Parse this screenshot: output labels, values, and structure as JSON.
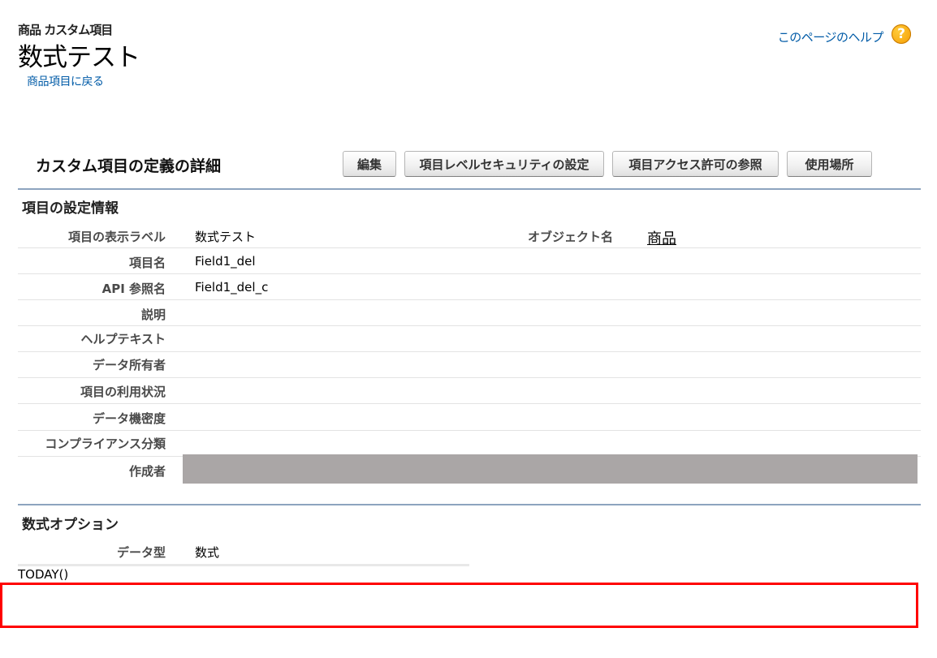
{
  "header": {
    "object_label": "商品 カスタム項目",
    "title": "数式テスト",
    "back_link": "商品項目に戻る",
    "help_link": "このページのヘルプ",
    "help_icon": "help-icon"
  },
  "detail": {
    "section_title": "カスタム項目の定義の詳細",
    "buttons": [
      "編集",
      "項目レベルセキュリティの設定",
      "項目アクセス許可の参照",
      "使用場所"
    ]
  },
  "field_info": {
    "heading": "項目の設定情報",
    "object_name_label": "オブジェクト名",
    "object_name_value": "商品",
    "rows": [
      {
        "label": "項目の表示ラベル",
        "value": "数式テスト"
      },
      {
        "label": "項目名",
        "value": "Field1_del"
      },
      {
        "label": "API 参照名",
        "value": "Field1_del_c"
      },
      {
        "label": "説明",
        "value": ""
      },
      {
        "label": "ヘルプテキスト",
        "value": ""
      },
      {
        "label": "データ所有者",
        "value": ""
      },
      {
        "label": "項目の利用状況",
        "value": ""
      },
      {
        "label": "データ機密度",
        "value": ""
      },
      {
        "label": "コンプライアンス分類",
        "value": ""
      },
      {
        "label": "作成者",
        "value": ""
      }
    ]
  },
  "formula_options": {
    "heading": "数式オプション",
    "data_type_label": "データ型",
    "data_type_value": "数式",
    "formula": "TODAY()"
  },
  "colors": {
    "link": "#015ba7",
    "rule": "#8da4bf",
    "highlight": "#ff0000",
    "redacted": "#aaa6a6"
  }
}
